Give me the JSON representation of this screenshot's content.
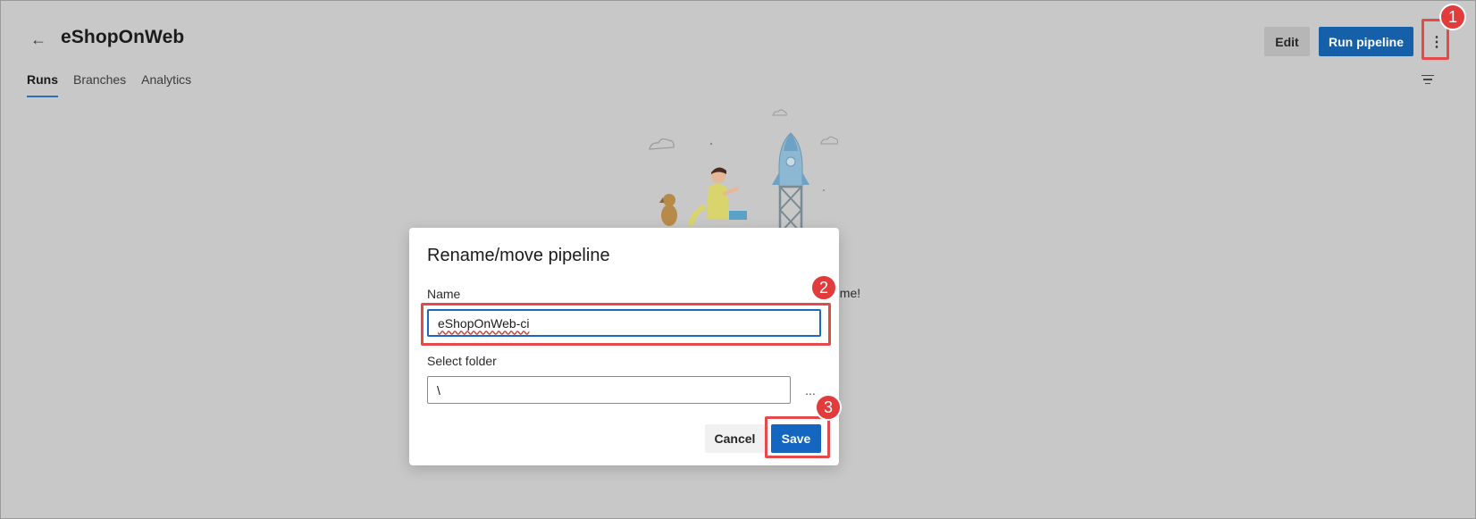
{
  "header": {
    "back_icon": "arrow-left-icon",
    "title": "eShopOnWeb",
    "edit_label": "Edit",
    "run_label": "Run pipeline",
    "more_icon": "more-vertical-icon",
    "filter_icon": "filter-icon"
  },
  "tabs": [
    {
      "label": "Runs",
      "active": true
    },
    {
      "label": "Branches",
      "active": false
    },
    {
      "label": "Analytics",
      "active": false
    }
  ],
  "background": {
    "text_fragment": "st time!"
  },
  "dialog": {
    "title": "Rename/move pipeline",
    "name_label": "Name",
    "name_value": "eShopOnWeb-ci",
    "folder_label": "Select folder",
    "folder_value": "\\",
    "folder_more": "...",
    "cancel_label": "Cancel",
    "save_label": "Save"
  },
  "annotations": {
    "step1": "1",
    "step2": "2",
    "step3": "3"
  },
  "colors": {
    "primary": "#1560a8",
    "annotation": "#e23b3b",
    "overlay": "#c8c8c8"
  }
}
